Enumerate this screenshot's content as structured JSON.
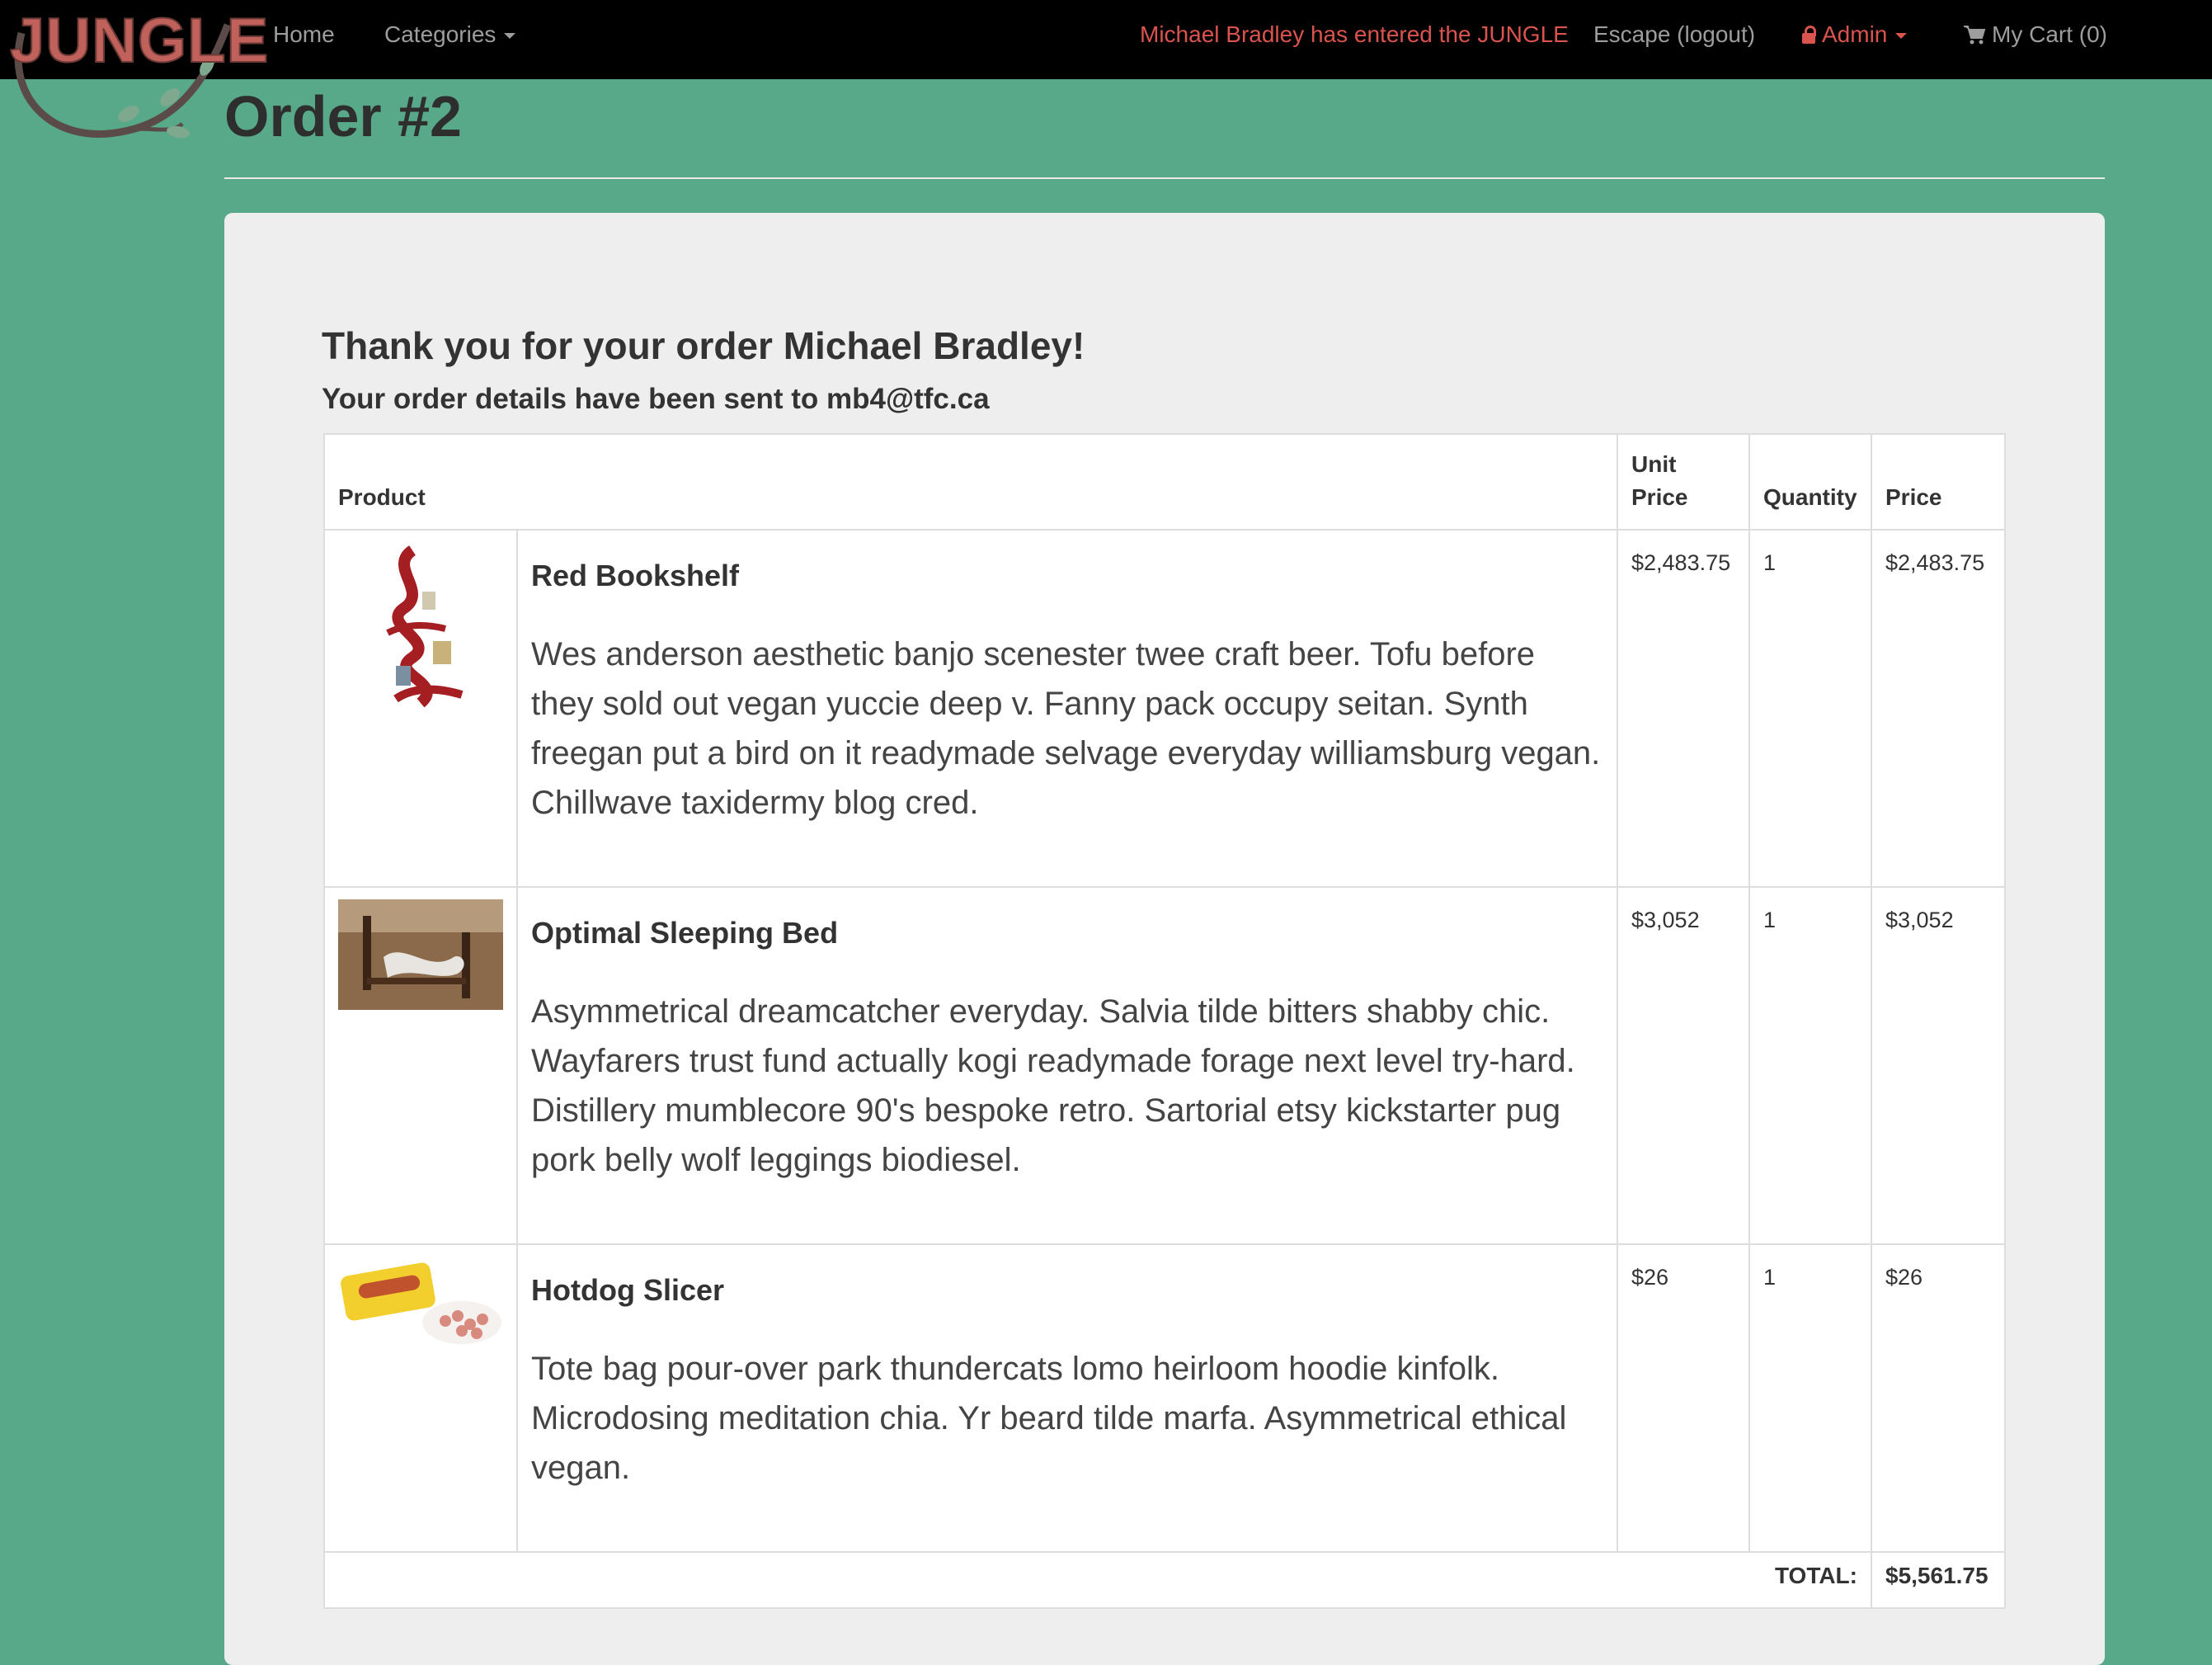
{
  "nav": {
    "brand": "JUNGLE",
    "home": "Home",
    "categories": "Categories",
    "welcome": "Michael Bradley has entered the JUNGLE",
    "logout": "Escape (logout)",
    "admin": "Admin",
    "cart": "My Cart (0)"
  },
  "page": {
    "title": "Order #2",
    "thanks": "Thank you for your order Michael Bradley!",
    "sent": "Your order details have been sent to mb4@tfc.ca"
  },
  "table": {
    "headers": {
      "product": "Product",
      "unit_price_1": "Unit",
      "unit_price_2": "Price",
      "quantity": "Quantity",
      "price": "Price"
    },
    "items": [
      {
        "name": "Red Bookshelf",
        "description": "Wes anderson aesthetic banjo scenester twee craft beer. Tofu before they sold out vegan yuccie deep v. Fanny pack occupy seitan. Synth freegan put a bird on it readymade selvage everyday williamsburg vegan. Chillwave taxidermy blog cred.",
        "unit_price": "$2,483.75",
        "quantity": "1",
        "price": "$2,483.75"
      },
      {
        "name": "Optimal Sleeping Bed",
        "description": "Asymmetrical dreamcatcher everyday. Salvia tilde bitters shabby chic. Wayfarers trust fund actually kogi readymade forage next level try-hard. Distillery mumblecore 90's bespoke retro. Sartorial etsy kickstarter pug pork belly wolf leggings biodiesel.",
        "unit_price": "$3,052",
        "quantity": "1",
        "price": "$3,052"
      },
      {
        "name": "Hotdog Slicer",
        "description": "Tote bag pour-over park thundercats lomo heirloom hoodie kinfolk. Microdosing meditation chia. Yr beard tilde marfa. Asymmetrical ethical vegan.",
        "unit_price": "$26",
        "quantity": "1",
        "price": "$26"
      }
    ],
    "total_label": "TOTAL:",
    "total_value": "$5,561.75"
  },
  "colors": {
    "background": "#57a98a",
    "navbar": "#000000",
    "accent_red": "#d9534f",
    "panel": "#eeeeee"
  },
  "icons": [
    "lock-icon",
    "cart-icon",
    "caret-down-icon"
  ]
}
